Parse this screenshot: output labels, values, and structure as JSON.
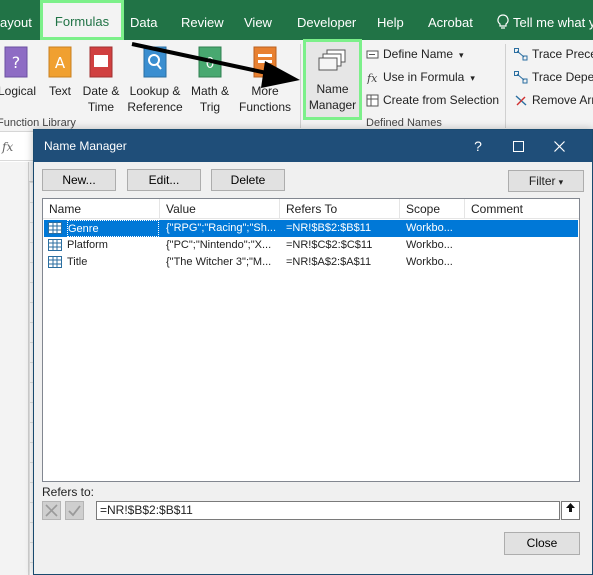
{
  "ribbon_tabs": [
    {
      "label": "ayout"
    },
    {
      "label": "Formulas"
    },
    {
      "label": "Data"
    },
    {
      "label": "Review"
    },
    {
      "label": "View"
    },
    {
      "label": "Developer"
    },
    {
      "label": "Help"
    },
    {
      "label": "Acrobat"
    }
  ],
  "tell_me": "Tell me what y",
  "function_library": {
    "group_label": "Function Library",
    "buttons": [
      {
        "line1": "Logical",
        "line2": ""
      },
      {
        "line1": "Text",
        "line2": ""
      },
      {
        "line1": "Date &",
        "line2": "Time"
      },
      {
        "line1": "Lookup &",
        "line2": "Reference"
      },
      {
        "line1": "Math &",
        "line2": "Trig"
      },
      {
        "line1": "More",
        "line2": "Functions"
      }
    ]
  },
  "defined_names": {
    "group_label": "Defined Names",
    "name_manager": {
      "line1": "Name",
      "line2": "Manager"
    },
    "define_name": "Define Name",
    "use_in_formula": "Use in Formula",
    "create_from_selection": "Create from Selection"
  },
  "formula_auditing": {
    "trace_precedents": "Trace Prece",
    "trace_dependents": "Trace Depen",
    "remove_arrows": "Remove Arr"
  },
  "formula_bar": {
    "fx": "fx"
  },
  "dialog": {
    "title": "Name Manager",
    "buttons": {
      "new": "New...",
      "edit": "Edit...",
      "delete": "Delete",
      "filter": "Filter"
    },
    "columns": [
      "Name",
      "Value",
      "Refers To",
      "Scope",
      "Comment"
    ],
    "rows": [
      {
        "name": "Genre",
        "value": "{\"RPG\";\"Racing\";\"Sh...",
        "refers_to": "=NR!$B$2:$B$11",
        "scope": "Workbo...",
        "comment": "",
        "selected": true
      },
      {
        "name": "Platform",
        "value": "{\"PC\";\"Nintendo\";\"X...",
        "refers_to": "=NR!$C$2:$C$11",
        "scope": "Workbo...",
        "comment": "",
        "selected": false
      },
      {
        "name": "Title",
        "value": "{\"The Witcher 3\";\"M...",
        "refers_to": "=NR!$A$2:$A$11",
        "scope": "Workbo...",
        "comment": "",
        "selected": false
      }
    ],
    "refers_to_label": "Refers to:",
    "refers_to_value": "=NR!$B$2:$B$11",
    "close": "Close"
  },
  "colors": {
    "excel_green": "#217346",
    "highlight": "#7cf08a",
    "dialog_title": "#1f4e79",
    "selection": "#0078d7"
  }
}
